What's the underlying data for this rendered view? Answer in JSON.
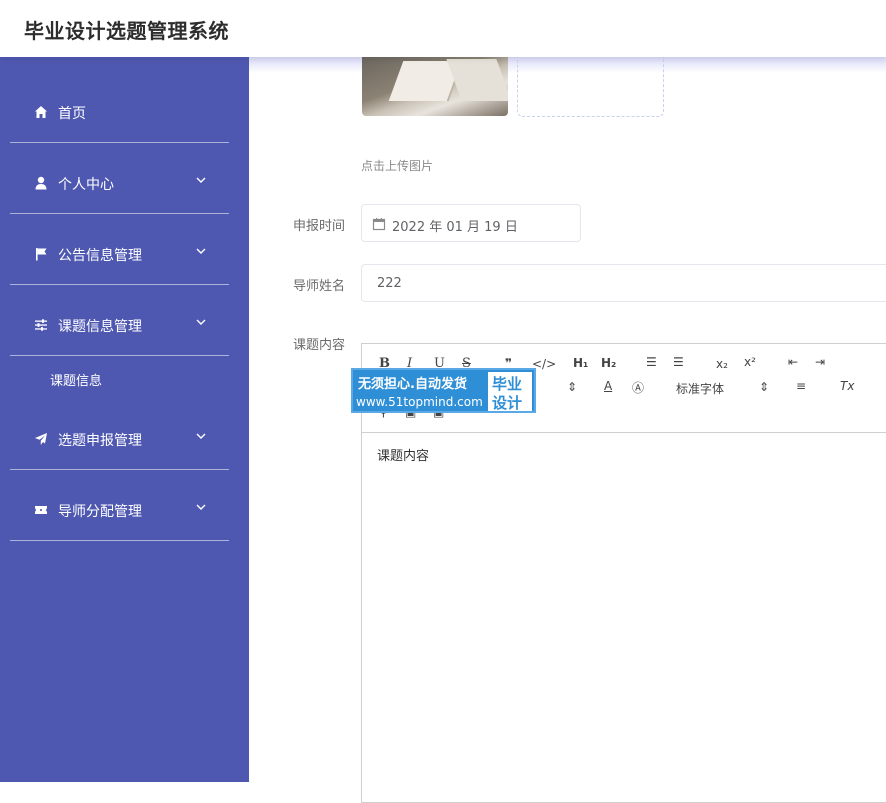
{
  "app": {
    "title": "毕业设计选题管理系统"
  },
  "sidebar": {
    "items": [
      {
        "label": "首页",
        "icon": "home-icon"
      },
      {
        "label": "个人中心",
        "icon": "user-icon"
      },
      {
        "label": "公告信息管理",
        "icon": "flag-icon"
      },
      {
        "label": "课题信息管理",
        "icon": "sliders-icon"
      },
      {
        "label": "选题申报管理",
        "icon": "send-icon"
      },
      {
        "label": "导师分配管理",
        "icon": "ticket-icon"
      }
    ],
    "sub_item": {
      "label": "课题信息"
    },
    "background": "#4f58b1"
  },
  "form": {
    "upload_hint": "点击上传图片",
    "date_label": "申报时间",
    "date_value": "2022 年 01 月 19 日",
    "teacher_label": "导师姓名",
    "teacher_value": "222",
    "content_label": "课题内容",
    "content_value": "课题内容"
  },
  "editor": {
    "font_select": "标准字体",
    "buttons": [
      "B",
      "I",
      "U",
      "S",
      "quote",
      "code",
      "H1",
      "H2",
      "ordered-list",
      "bullet-list",
      "subscript",
      "superscript",
      "outdent",
      "indent"
    ]
  },
  "watermark": {
    "line1": "无须担心.自动发货",
    "line2": "www.51topmind.com",
    "box1": "毕业",
    "box2": "设计"
  }
}
